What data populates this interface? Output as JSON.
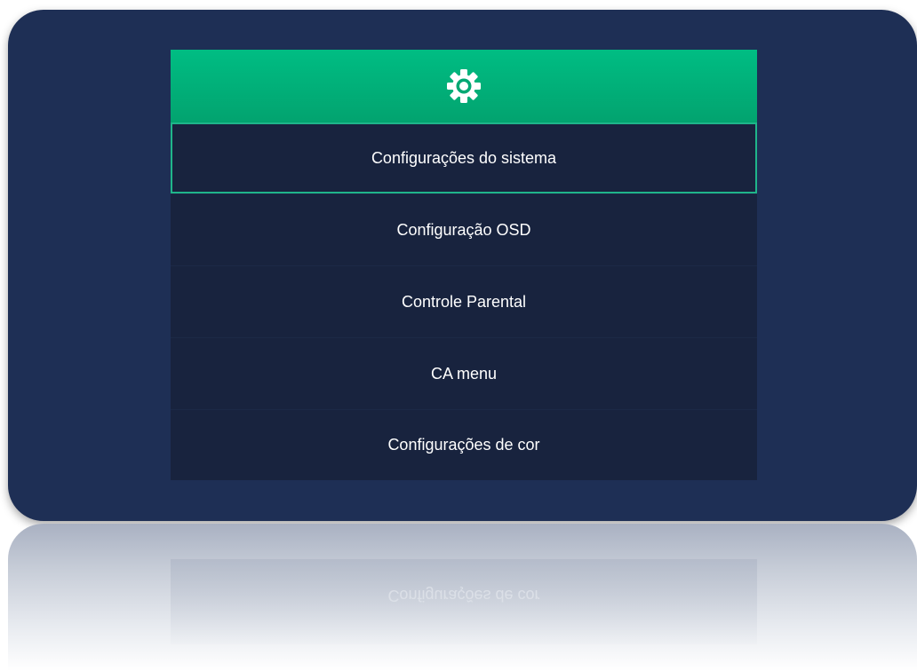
{
  "header": {
    "icon": "gear-icon",
    "color": "#00b27a"
  },
  "menu": {
    "items": [
      {
        "label": "Configurações do sistema",
        "selected": true
      },
      {
        "label": "Configuração OSD",
        "selected": false
      },
      {
        "label": "Controle Parental",
        "selected": false
      },
      {
        "label": "CA menu",
        "selected": false
      },
      {
        "label": "Configurações de cor",
        "selected": false
      }
    ]
  },
  "reflection": {
    "label": "Configurações de cor"
  },
  "colors": {
    "background": "#1e2f55",
    "item_background": "#18233e",
    "selection_border": "#1fb58a",
    "text": "#ffffff"
  }
}
